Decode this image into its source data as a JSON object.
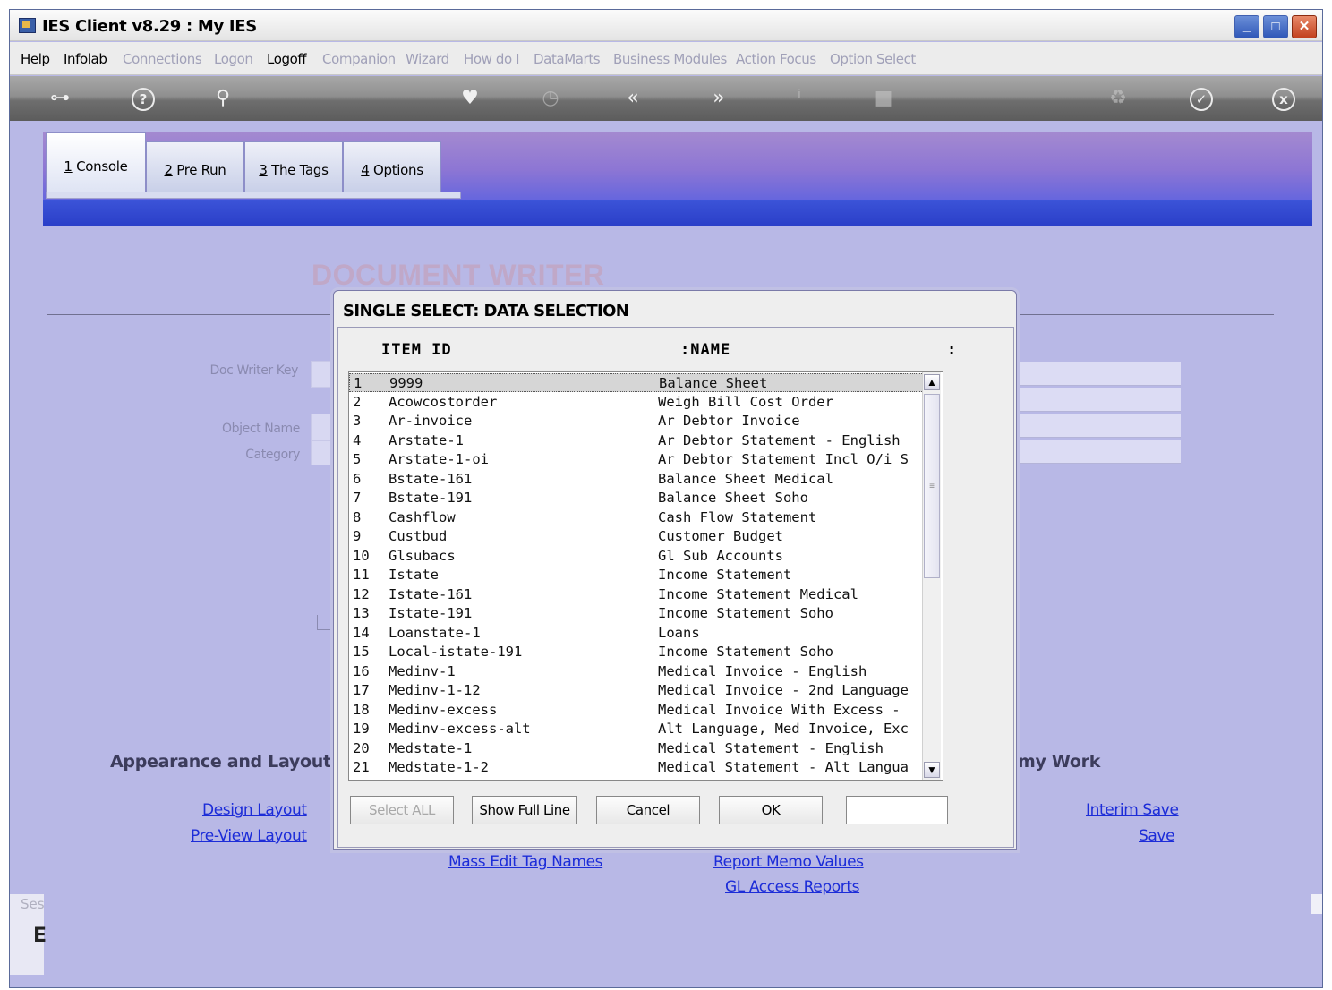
{
  "window": {
    "title": "IES Client v8.29 : My IES"
  },
  "menu": [
    {
      "label": "Help",
      "enabled": true
    },
    {
      "label": "Infolab",
      "enabled": true
    },
    {
      "label": "Connections",
      "enabled": false
    },
    {
      "label": "Logon",
      "enabled": false
    },
    {
      "label": "Logoff",
      "enabled": true
    },
    {
      "label": "Companion",
      "enabled": false
    },
    {
      "label": "Wizard",
      "enabled": false
    },
    {
      "label": "How do I",
      "enabled": false
    },
    {
      "label": "DataMarts",
      "enabled": false
    },
    {
      "label": "Business Modules",
      "enabled": false
    },
    {
      "label": "Action Focus",
      "enabled": false
    },
    {
      "label": "Option Select",
      "enabled": false
    }
  ],
  "toolbar": {
    "icons": [
      "key-icon",
      "help-icon",
      "search-icon",
      "heart-icon",
      "clock-icon",
      "rewind-icon",
      "fast-forward-icon",
      "info-icon",
      "stop-icon",
      "recycle-icon",
      "check-icon",
      "close-icon"
    ]
  },
  "tabs": [
    {
      "num": "1",
      "label": " Console"
    },
    {
      "num": "2",
      "label": " Pre Run"
    },
    {
      "num": "3",
      "label": " The Tags"
    },
    {
      "num": "4",
      "label": " Options"
    }
  ],
  "page": {
    "title": "DOCUMENT WRITER",
    "fields": {
      "doc_writer_key": "Doc Writer Key",
      "object_name": "Object Name",
      "category": "Category"
    },
    "appearance_heading": "Appearance and Layout",
    "work_heading": "my Work",
    "links": {
      "design_layout": "Design Layout",
      "preview_layout": "Pre-View Layout",
      "interim_save": "Interim Save",
      "save": "Save",
      "mass_edit": "Mass Edit Tag Names",
      "report_memo": "Report Memo Values",
      "gl_access": "GL Access Reports"
    },
    "session_label": "Ses",
    "session_value": "E"
  },
  "dialog": {
    "title": "SINGLE SELECT: DATA SELECTION",
    "col_item": "ITEM ID",
    "col_name": ":NAME",
    "col_end": ":",
    "rows": [
      {
        "n": "1",
        "id": "9999",
        "name": "Balance Sheet"
      },
      {
        "n": "2",
        "id": "Acowcostorder",
        "name": "Weigh Bill Cost Order"
      },
      {
        "n": "3",
        "id": "Ar-invoice",
        "name": "Ar Debtor Invoice"
      },
      {
        "n": "4",
        "id": "Arstate-1",
        "name": "Ar Debtor Statement - English"
      },
      {
        "n": "5",
        "id": "Arstate-1-oi",
        "name": "Ar Debtor Statement Incl O/i S"
      },
      {
        "n": "6",
        "id": "Bstate-161",
        "name": "Balance Sheet Medical"
      },
      {
        "n": "7",
        "id": "Bstate-191",
        "name": "Balance Sheet Soho"
      },
      {
        "n": "8",
        "id": "Cashflow",
        "name": "Cash Flow Statement"
      },
      {
        "n": "9",
        "id": "Custbud",
        "name": "Customer Budget"
      },
      {
        "n": "10",
        "id": "Glsubacs",
        "name": "Gl Sub Accounts"
      },
      {
        "n": "11",
        "id": "Istate",
        "name": "Income Statement"
      },
      {
        "n": "12",
        "id": "Istate-161",
        "name": "Income Statement Medical"
      },
      {
        "n": "13",
        "id": "Istate-191",
        "name": "Income Statement Soho"
      },
      {
        "n": "14",
        "id": "Loanstate-1",
        "name": "Loans"
      },
      {
        "n": "15",
        "id": "Local-istate-191",
        "name": "Income Statement Soho"
      },
      {
        "n": "16",
        "id": "Medinv-1",
        "name": "Medical Invoice - English"
      },
      {
        "n": "17",
        "id": "Medinv-1-12",
        "name": "Medical Invoice - 2nd Language"
      },
      {
        "n": "18",
        "id": "Medinv-excess",
        "name": "Medical Invoice With Excess -"
      },
      {
        "n": "19",
        "id": "Medinv-excess-alt",
        "name": "Alt Language, Med Invoice, Exc"
      },
      {
        "n": "20",
        "id": "Medstate-1",
        "name": "Medical Statement - English"
      },
      {
        "n": "21",
        "id": "Medstate-1-2",
        "name": "Medical Statement - Alt Langua"
      }
    ],
    "buttons": {
      "select_all": "Select ALL",
      "show_full_line": "Show Full Line",
      "cancel": "Cancel",
      "ok": "OK"
    },
    "input_value": ""
  }
}
